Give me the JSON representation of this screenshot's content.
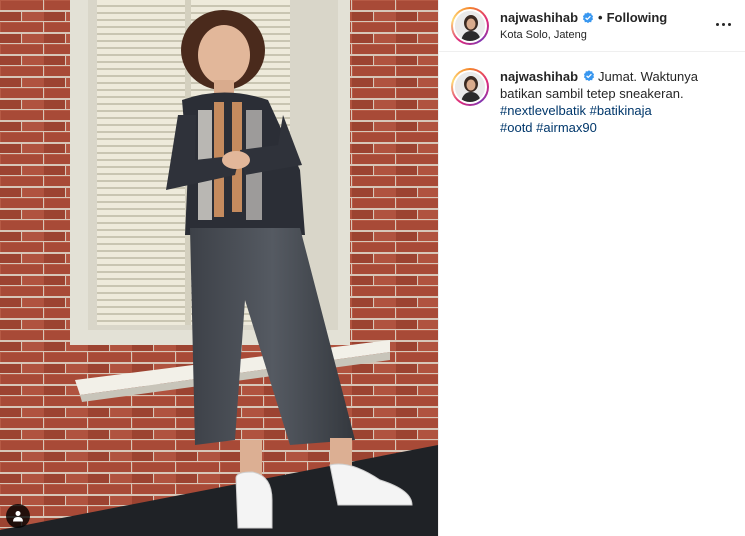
{
  "post": {
    "username": "najwashihab",
    "separator": "•",
    "follow_status": "Following",
    "location": "Kota Solo, Jateng",
    "more_icon": "more-horizontal-icon",
    "verified_icon": "verified-badge-icon"
  },
  "caption": {
    "username": "najwashihab",
    "line1": "Jumat. Waktunya",
    "line2": "batikan sambil tetep sneakeran.",
    "hashtags": [
      "#nextlevelbatik",
      "#batikinaja",
      "#ootd",
      "#airmax90"
    ]
  },
  "photo": {
    "tag_icon": "user-tag-icon"
  },
  "colors": {
    "brick": "#8a3a2b",
    "window_frame": "#e8e6dc",
    "shutter": "#f0eedc",
    "hashtag_link": "#00376b",
    "verified_blue": "#3897f0"
  }
}
